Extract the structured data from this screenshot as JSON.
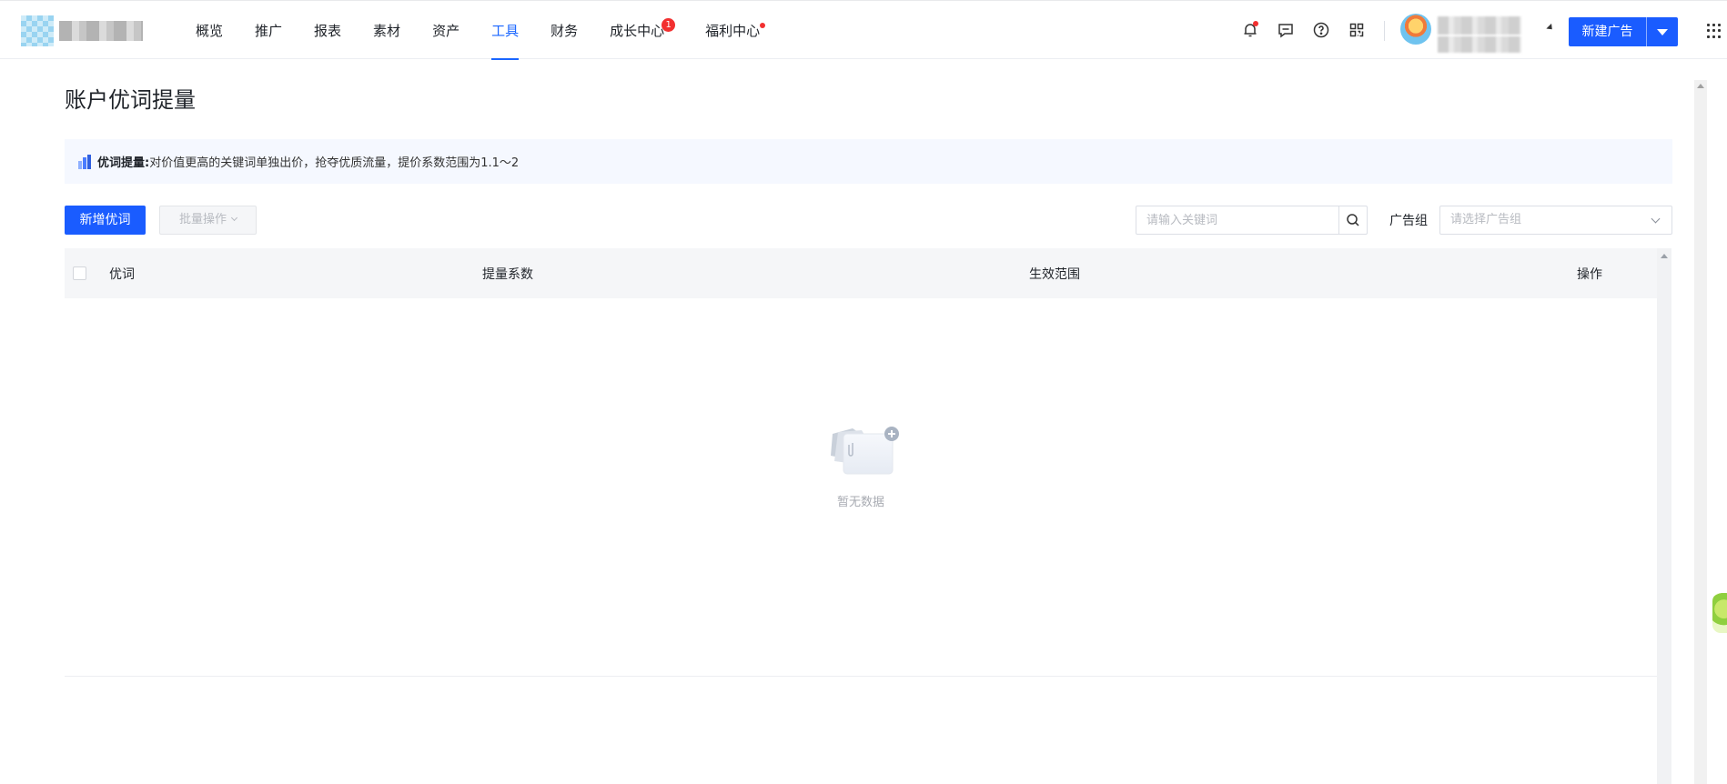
{
  "nav": {
    "items": [
      {
        "label": "概览"
      },
      {
        "label": "推广"
      },
      {
        "label": "报表"
      },
      {
        "label": "素材"
      },
      {
        "label": "资产"
      },
      {
        "label": "工具",
        "active": true
      },
      {
        "label": "财务"
      },
      {
        "label": "成长中心",
        "badge": "1"
      },
      {
        "label": "福利中心",
        "dot": true
      }
    ],
    "icons": [
      "bell-icon",
      "message-icon",
      "help-icon",
      "qrcode-icon"
    ],
    "new_ad_label": "新建广告",
    "accent_color": "#1a5cff"
  },
  "page": {
    "title": "账户优词提量",
    "info": {
      "strong": "优词提量:",
      "text": "对价值更高的关键词单独出价，抢夺优质流量，提价系数范围为1.1～2"
    },
    "toolbar": {
      "add_label": "新增优词",
      "batch_label": "批量操作",
      "search_placeholder": "请输入关键词",
      "adgroup_label": "广告组",
      "adgroup_placeholder": "请选择广告组"
    },
    "table": {
      "columns": [
        "优词",
        "提量系数",
        "生效范围",
        "操作"
      ],
      "rows": [],
      "empty_text": "暂无数据"
    }
  }
}
